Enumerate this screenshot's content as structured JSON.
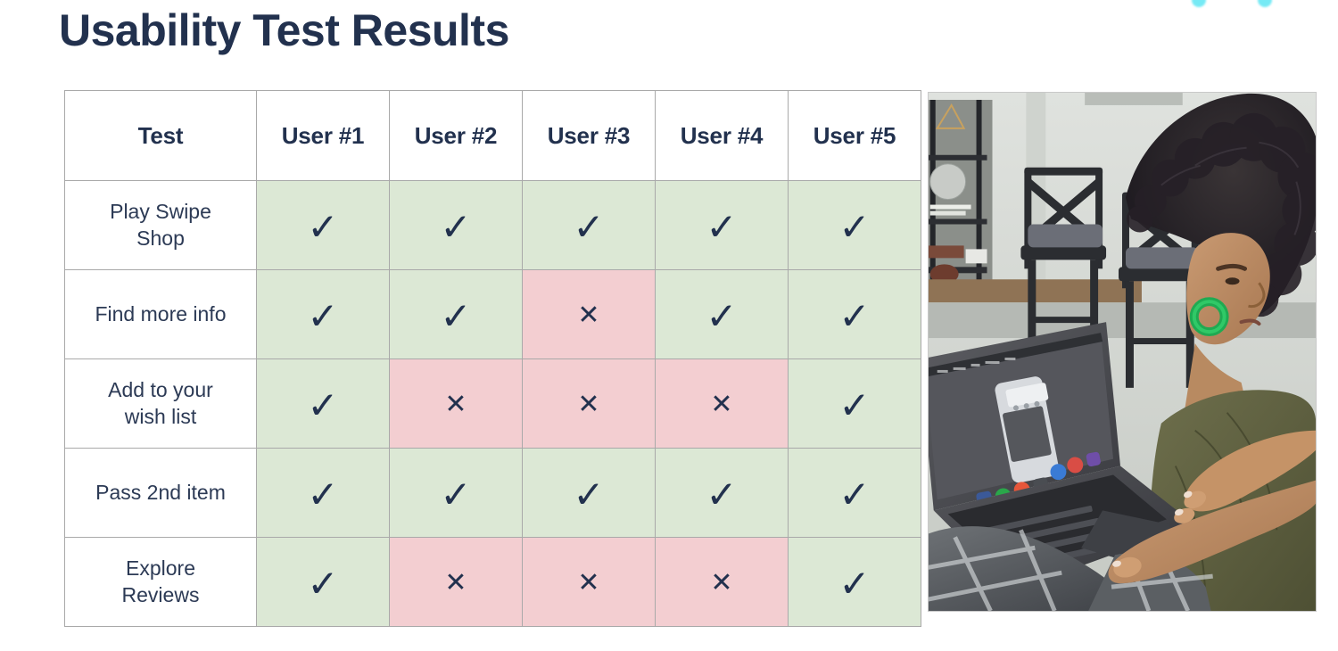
{
  "page": {
    "title": "Usability Test Results",
    "background_color": "#ffffff",
    "title_color": "#22314e"
  },
  "decoration": {
    "name": "sparkle-accent",
    "color": "#49e3f2"
  },
  "table": {
    "columns": [
      "Test",
      "User #1",
      "User #2",
      "User #3",
      "User #4",
      "User #5"
    ],
    "pass_color": "#dce8d5",
    "fail_color": "#f3ced1",
    "border_color": "#a9a9a9",
    "mark_color": "#22314e",
    "pass_glyph": "✓",
    "fail_glyph": "✕",
    "rows": [
      {
        "label": "Play Swipe Shop",
        "label_lines": [
          "Play Swipe",
          "Shop"
        ],
        "results": [
          "pass",
          "pass",
          "pass",
          "pass",
          "pass"
        ],
        "marks": [
          "✓",
          "✓",
          "✓",
          "✓",
          "✓"
        ]
      },
      {
        "label": "Find more info",
        "label_lines": [
          "Find more info"
        ],
        "results": [
          "pass",
          "pass",
          "fail",
          "pass",
          "pass"
        ],
        "marks": [
          "✓",
          "✓",
          "✕",
          "✓",
          "✓"
        ]
      },
      {
        "label": "Add to your wish list",
        "label_lines": [
          "Add to your",
          "wish list"
        ],
        "results": [
          "pass",
          "fail",
          "fail",
          "fail",
          "pass"
        ],
        "marks": [
          "✓",
          "✕",
          "✕",
          "✕",
          "✓"
        ]
      },
      {
        "label": "Pass 2nd item",
        "label_lines": [
          "Pass 2nd item"
        ],
        "results": [
          "pass",
          "pass",
          "pass",
          "pass",
          "pass"
        ],
        "marks": [
          "✓",
          "✓",
          "✓",
          "✓",
          "✓"
        ]
      },
      {
        "label": "Explore Reviews",
        "label_lines": [
          "Explore",
          "Reviews"
        ],
        "results": [
          "pass",
          "fail",
          "fail",
          "fail",
          "pass"
        ],
        "marks": [
          "✓",
          "✕",
          "✕",
          "✕",
          "✓"
        ]
      }
    ]
  },
  "photo": {
    "name": "usability-test-session-photo",
    "description": "Woman with curly dark hair and a green hoop earring, wearing an olive green shirt, seated with a plaid grey blanket on her lap, using a laptop that displays a mirrored phone screen. Two dark wooden bar stools and a shelving unit are behind her."
  }
}
